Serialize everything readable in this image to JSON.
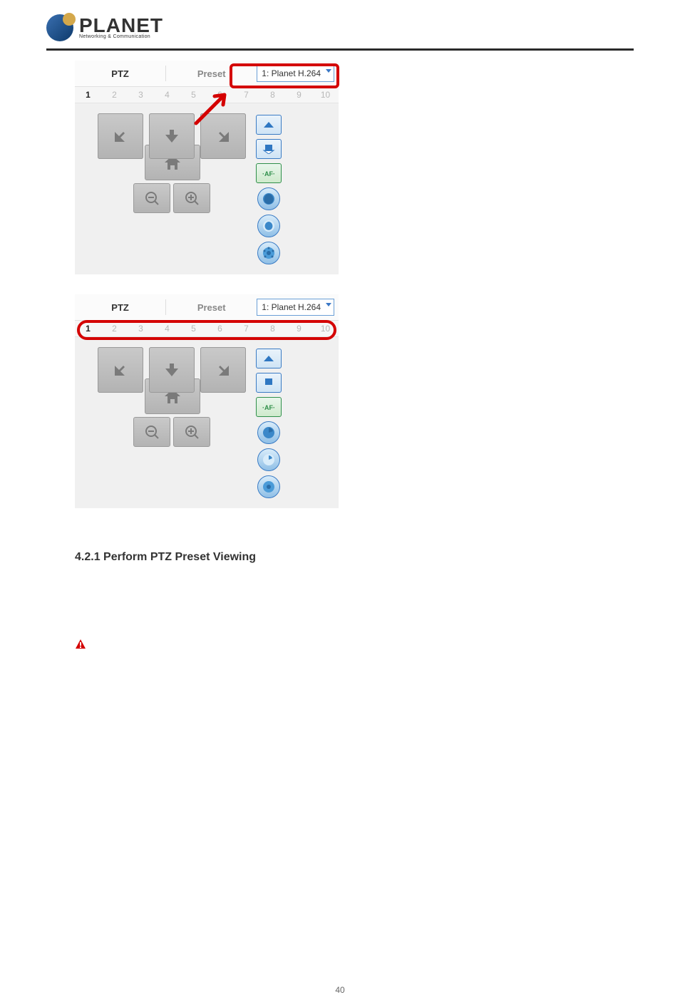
{
  "logo": {
    "brand": "PLANET",
    "tagline": "Networking & Communication"
  },
  "ptz": {
    "tabs": {
      "ptz": "PTZ",
      "preset": "Preset"
    },
    "dropdown": "1: Planet H.264",
    "numbers": [
      "1",
      "2",
      "3",
      "4",
      "5",
      "6",
      "7",
      "8",
      "9",
      "10"
    ]
  },
  "section": "4.2.1 Perform PTZ Preset Viewing",
  "page_number": "40"
}
